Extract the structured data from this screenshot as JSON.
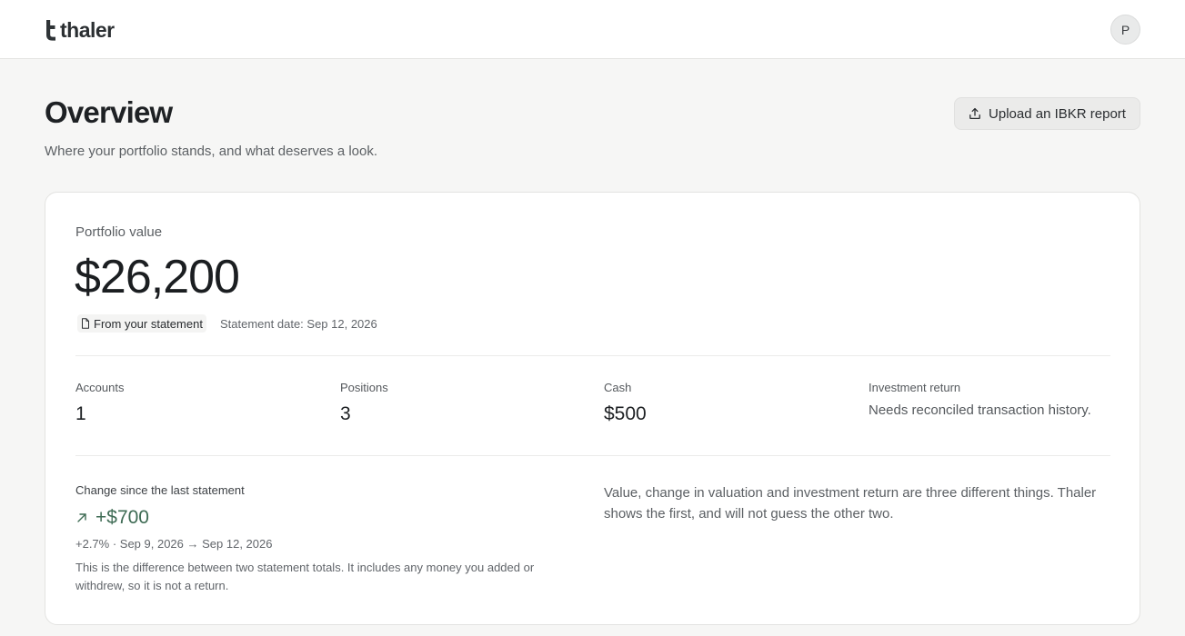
{
  "header": {
    "brand_name": "thaler",
    "avatar_initial": "P"
  },
  "page": {
    "title": "Overview",
    "subtitle": "Where your portfolio stands, and what deserves a look.",
    "upload_label": "Upload an IBKR report"
  },
  "portfolio": {
    "label": "Portfolio value",
    "value": "$26,200",
    "source_chip": "From your statement",
    "statement_date": "Statement date: Sep 12, 2026"
  },
  "stats": {
    "accounts": {
      "label": "Accounts",
      "value": "1"
    },
    "positions": {
      "label": "Positions",
      "value": "3"
    },
    "cash": {
      "label": "Cash",
      "value": "$500"
    },
    "investment_return": {
      "label": "Investment return",
      "note": "Needs reconciled transaction history."
    }
  },
  "change": {
    "label": "Change since the last statement",
    "value": "+$700",
    "meta": "+2.7% · Sep 9, 2026 → Sep 12, 2026",
    "description": "This is the difference between two statement totals. It includes any money you added or withdrew, so it is not a return."
  },
  "explainer": "Value, change in valuation and investment return are three different things. Thaler shows the first, and will not guess the other two.",
  "colors": {
    "accent_green": "#3e6b54",
    "background": "#f6f6f5",
    "text_primary": "#1d1f21"
  }
}
